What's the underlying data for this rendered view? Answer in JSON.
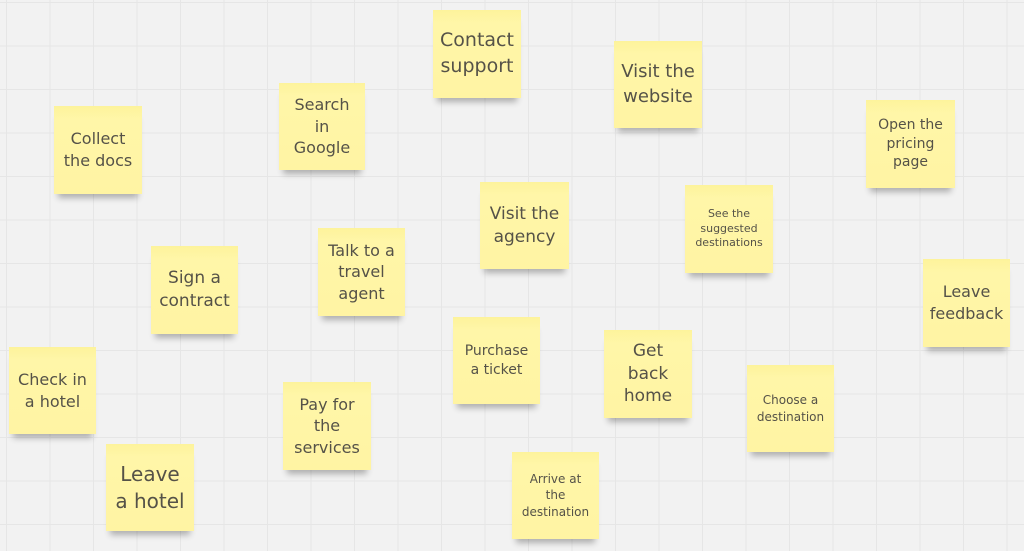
{
  "board": {
    "background_color": "#f2f2f2",
    "note_color": "#fff4a3",
    "notes": [
      {
        "id": "contact-support",
        "text": "Contact\nsupport"
      },
      {
        "id": "visit-website",
        "text": "Visit the\nwebsite"
      },
      {
        "id": "collect-docs",
        "text": "Collect\nthe docs"
      },
      {
        "id": "search-google",
        "text": "Search\nin\nGoogle"
      },
      {
        "id": "open-pricing",
        "text": "Open the\npricing\npage"
      },
      {
        "id": "visit-agency",
        "text": "Visit the\nagency"
      },
      {
        "id": "suggested-destinations",
        "text": "See the\nsuggested\ndestinations"
      },
      {
        "id": "sign-contract",
        "text": "Sign a\ncontract"
      },
      {
        "id": "talk-agent",
        "text": "Talk to a\ntravel\nagent"
      },
      {
        "id": "leave-feedback",
        "text": "Leave\nfeedback"
      },
      {
        "id": "check-in-hotel",
        "text": "Check in\na hotel"
      },
      {
        "id": "purchase-ticket",
        "text": "Purchase\na ticket"
      },
      {
        "id": "get-back-home",
        "text": "Get back\nhome"
      },
      {
        "id": "pay-services",
        "text": "Pay for\nthe\nservices"
      },
      {
        "id": "choose-destination",
        "text": "Choose a\ndestination"
      },
      {
        "id": "leave-hotel",
        "text": "Leave\na hotel"
      },
      {
        "id": "arrive-destination",
        "text": "Arrive at\nthe\ndestination"
      }
    ]
  }
}
